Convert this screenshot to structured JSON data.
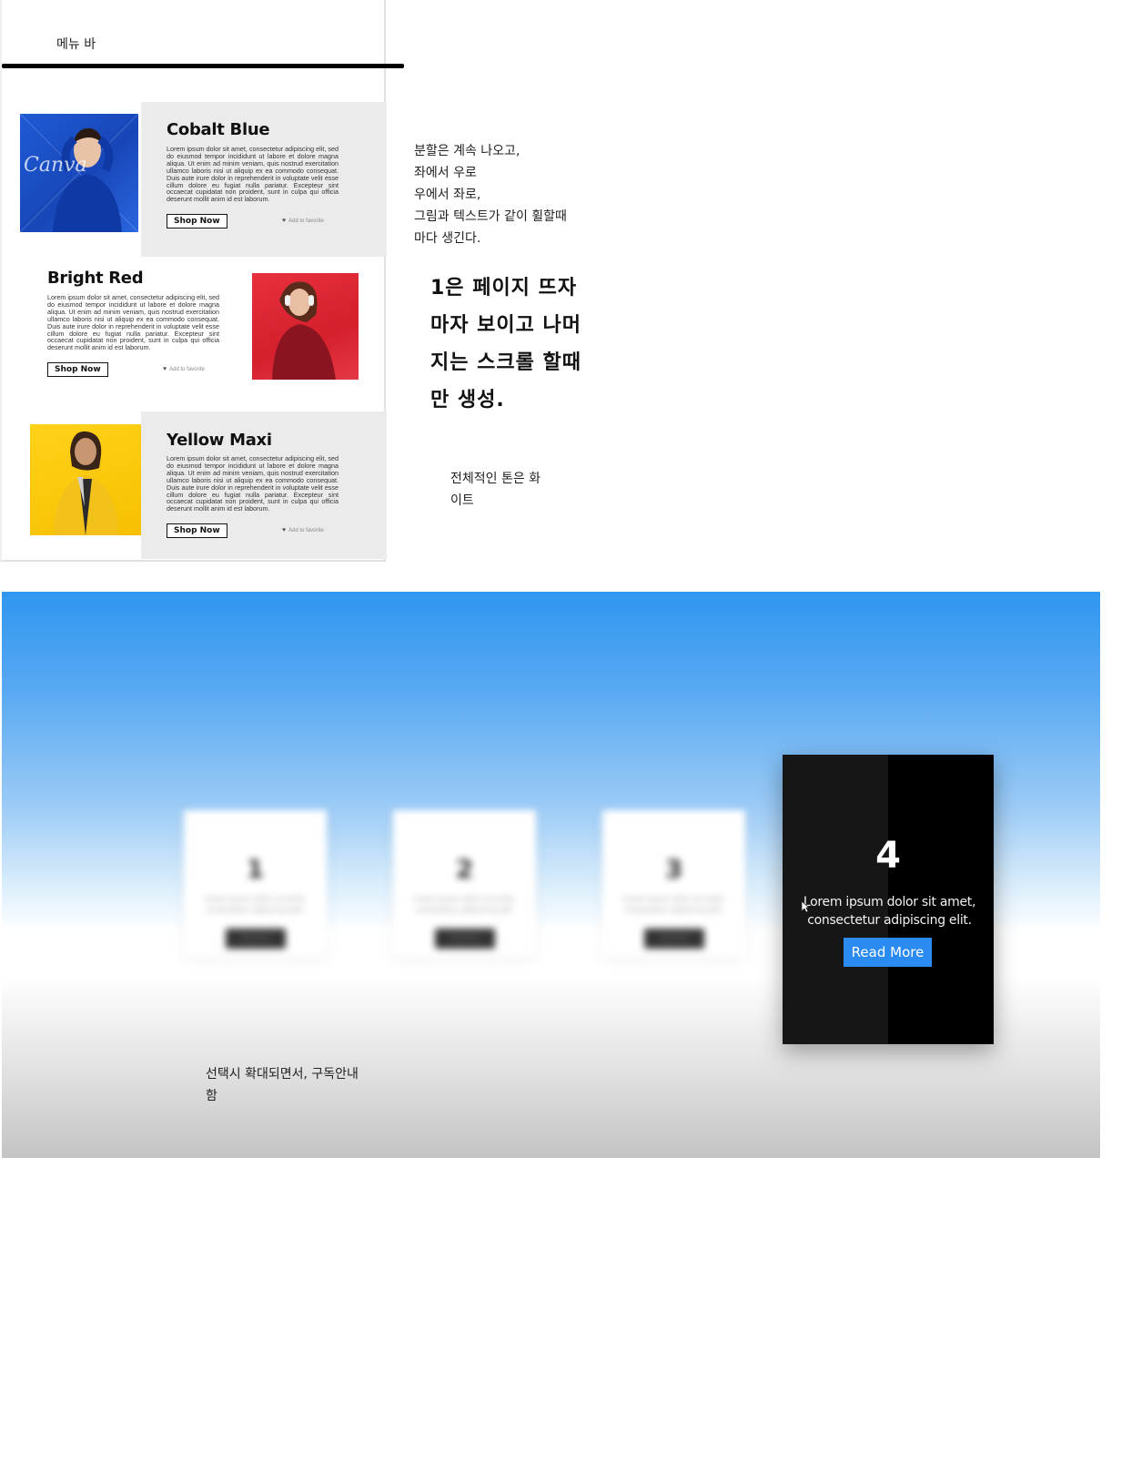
{
  "menubar": {
    "label": "메뉴 바"
  },
  "products": [
    {
      "title": "Cobalt Blue",
      "description": "Lorem ipsum dolor sit amet, consectetur adipiscing elit, sed do eiusmod tempor incididunt ut labore et dolore magna aliqua. Ut enim ad minim veniam, quis nostrud exercitation ullamco laboris nisi ut aliquip ex ea commodo consequat. Duis aute irure dolor in reprehenderit in voluptate velit esse cillum dolore eu fugiat nulla pariatur. Excepteur sint occaecat cupidatat non proident, sunt in culpa qui officia deserunt mollit anim id est laborum.",
      "shop_label": "Shop Now",
      "favorite_label": "Add to favorite",
      "watermark": "Canva",
      "accent": "#1e5bd6"
    },
    {
      "title": "Bright Red",
      "description": "Lorem ipsum dolor sit amet, consectetur adipiscing elit, sed do eiusmod tempor incididunt ut labore et dolore magna aliqua. Ut enim ad minim veniam, quis nostrud exercitation ullamco laboris nisi ut aliquip ex ea commodo consequat. Duis aute irure dolor in reprehenderit in voluptate velit esse cillum dolore eu fugiat nulla pariatur. Excepteur sint occaecat cupidatat non proident, sunt in culpa qui officia deserunt mollit anim id est laborum.",
      "shop_label": "Shop Now",
      "favorite_label": "Add to favorite",
      "accent": "#e02a36"
    },
    {
      "title": "Yellow Maxi",
      "description": "Lorem ipsum dolor sit amet, consectetur adipiscing elit, sed do eiusmod tempor incididunt ut labore et dolore magna aliqua. Ut enim ad minim veniam, quis nostrud exercitation ullamco laboris nisi ut aliquip ex ea commodo consequat. Duis aute irure dolor in reprehenderit in voluptate velit esse cillum dolore eu fugiat nulla pariatur. Excepteur sint occaecat cupidatat non proident, sunt in culpa qui officia deserunt mollit anim id est laborum.",
      "shop_label": "Shop Now",
      "favorite_label": "Add to favorite",
      "accent": "#fcc800"
    }
  ],
  "notes": {
    "split": [
      "분할은 계속 나오고,",
      "좌에서 우로",
      "우에서 좌로,",
      "그림과 텍스트가 같이 휠할때",
      "마다 생긴다."
    ],
    "first_page": [
      "1은 페이지 뜨자",
      "마자 보이고 나머",
      "지는 스크롤 할때",
      "만 생성."
    ],
    "tone": [
      "전체적인 톤은 화",
      "이트"
    ],
    "select": [
      "선택시 확대되면서, 구독안내",
      "함"
    ]
  },
  "cards": [
    {
      "number": "1",
      "text": "Lorem ipsum dolor sit amet, consectetur adipiscing elit.",
      "button": "Read More"
    },
    {
      "number": "2",
      "text": "Lorem ipsum dolor sit amet, consectetur adipiscing elit.",
      "button": "Read More"
    },
    {
      "number": "3",
      "text": "Lorem ipsum dolor sit amet, consectetur adipiscing elit.",
      "button": "Read More"
    },
    {
      "number": "4",
      "text": "Lorem ipsum dolor sit amet, consectetur adipiscing elit.",
      "button": "Read More",
      "active": true
    }
  ],
  "colors": {
    "sky_top": "#2f96f0",
    "read_more_button": "#2a8bf2",
    "active_card": "#000000"
  }
}
